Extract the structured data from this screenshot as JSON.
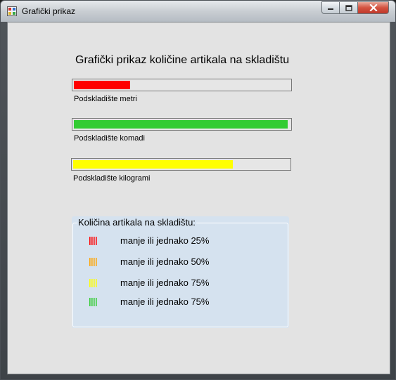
{
  "window": {
    "title": "Grafički prikaz",
    "icon": "app-icon",
    "controls": [
      "minimize-icon",
      "maximize-icon",
      "close-icon"
    ]
  },
  "main": {
    "heading": "Grafički prikaz količine artikala na skladištu",
    "bars": [
      {
        "label": "Podskladište metri",
        "fill": 0.26,
        "color": "#ff0000"
      },
      {
        "label": "Podskladište komadi",
        "fill": 0.99,
        "color": "#33cc33"
      },
      {
        "label": "Podskladište kilogrami",
        "fill": 0.74,
        "color": "#ffff00"
      }
    ]
  },
  "legend": {
    "title": "Količina artikala na skladištu:",
    "items": [
      {
        "text": "manje ili jednako 25%",
        "color": "#ff0000"
      },
      {
        "text": "manje ili jednako 50%",
        "color": "#ffa500"
      },
      {
        "text": "manje ili jednako 75%",
        "color": "#ffff00"
      },
      {
        "text": "manje ili jednako 75%",
        "color": "#33cc33"
      }
    ]
  }
}
